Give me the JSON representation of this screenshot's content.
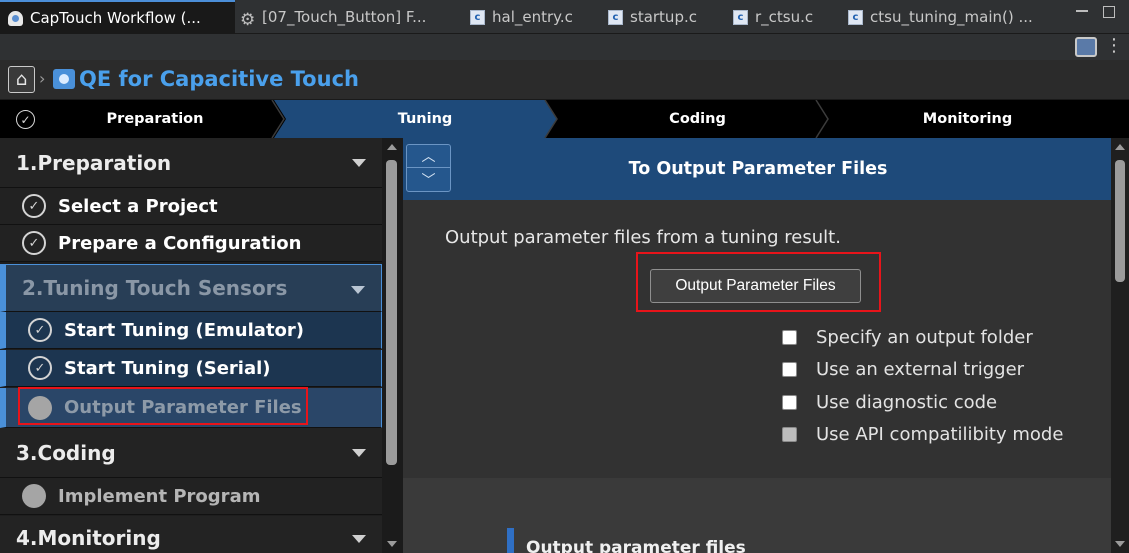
{
  "tabs": [
    {
      "label": "CapTouch Workflow (...",
      "icon": "workflow-icon",
      "active": true
    },
    {
      "label": "[07_Touch_Button] F...",
      "icon": "gear-icon"
    },
    {
      "label": "hal_entry.c",
      "icon": "c-file-icon"
    },
    {
      "label": "startup.c",
      "icon": "c-file-icon"
    },
    {
      "label": "r_ctsu.c",
      "icon": "c-file-icon"
    },
    {
      "label": "ctsu_tuning_main() ...",
      "icon": "c-file-icon"
    }
  ],
  "header": {
    "title": "QE for Capacitive Touch",
    "home_icon": "home-icon",
    "title_icon": "qe-touch-icon",
    "title_color": "#4aa0ec"
  },
  "steps": [
    {
      "label": "Preparation",
      "state": "done"
    },
    {
      "label": "Tuning",
      "state": "current"
    },
    {
      "label": "Coding",
      "state": "todo"
    },
    {
      "label": "Monitoring",
      "state": "todo"
    }
  ],
  "sidebar": {
    "sections": [
      {
        "title": "1.Preparation",
        "items": [
          {
            "label": "Select a Project",
            "state": "done"
          },
          {
            "label": "Prepare a Configuration",
            "state": "done"
          }
        ]
      },
      {
        "title": "2.Tuning Touch Sensors",
        "items": [
          {
            "label": "Start Tuning (Emulator)",
            "state": "done"
          },
          {
            "label": "Start Tuning (Serial)",
            "state": "done"
          },
          {
            "label": "Output Parameter Files",
            "state": "current"
          }
        ]
      },
      {
        "title": "3.Coding",
        "items": [
          {
            "label": "Implement Program",
            "state": "todo"
          }
        ]
      },
      {
        "title": "4.Monitoring",
        "items": []
      }
    ]
  },
  "main": {
    "heading": "To Output Parameter Files",
    "description": "Output parameter files from a tuning result.",
    "button_label": "Output Parameter Files",
    "options": [
      {
        "label": "Specify an output folder",
        "checked": false,
        "enabled": true
      },
      {
        "label": "Use an external trigger",
        "checked": false,
        "enabled": true
      },
      {
        "label": "Use diagnostic code",
        "checked": false,
        "enabled": true
      },
      {
        "label": "Use API compatilibity mode",
        "checked": false,
        "enabled": false
      }
    ],
    "lower_title": "Output parameter files"
  },
  "colors": {
    "accent": "#4a90d9",
    "highlight": "#e8141a",
    "current_step": "#1e4a7a"
  }
}
